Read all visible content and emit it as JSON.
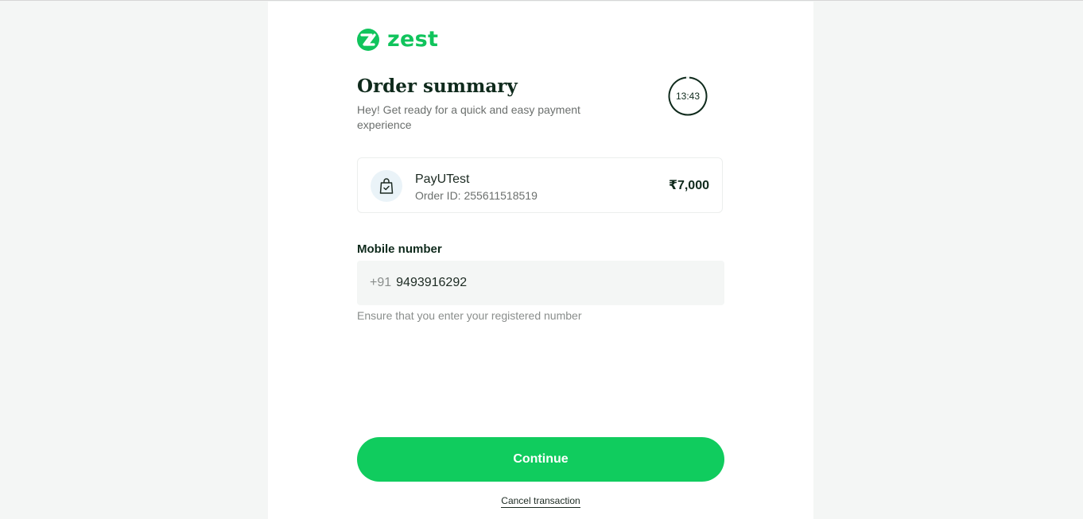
{
  "brand": {
    "name": "zest",
    "icon": "zest-logo-icon",
    "color": "#10c45c"
  },
  "header": {
    "title": "Order summary",
    "subtitle": "Hey! Get ready for a quick and easy payment experience",
    "timer": "13:43"
  },
  "merchant": {
    "icon": "shopping-bag-icon",
    "name": "PayUTest",
    "order_id": "Order ID: 255611518519",
    "amount": "₹7,000"
  },
  "mobile": {
    "label": "Mobile number",
    "prefix": "+91",
    "value": "9493916292",
    "helper": "Ensure that you enter your registered number"
  },
  "actions": {
    "continue_label": "Continue",
    "cancel_label": "Cancel transaction",
    "accent": "#10cc5e"
  }
}
